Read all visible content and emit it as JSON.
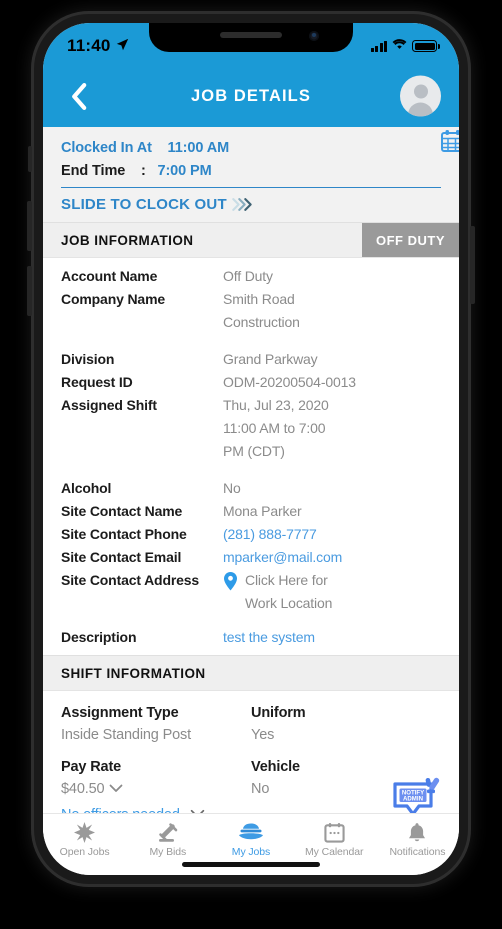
{
  "status_bar": {
    "time": "11:40",
    "location_icon": "location-arrow-icon",
    "signal_icon": "cellular-signal-icon",
    "wifi_icon": "wifi-icon",
    "battery_icon": "battery-icon"
  },
  "nav": {
    "back_icon": "chevron-left-icon",
    "title": "JOB DETAILS",
    "avatar_icon": "user-avatar-icon",
    "bg_color": "#1B9AD6"
  },
  "clock_panel": {
    "clocked_in_label": "Clocked In At",
    "clocked_in_value": "11:00 AM",
    "end_time_label": "End Time",
    "end_time_sep": ":",
    "end_time_value": "7:00 PM",
    "slide_label": "SLIDE TO CLOCK OUT",
    "slide_icon": "triple-chevron-right-icon",
    "accent_color": "#2E86C8"
  },
  "job_information": {
    "section_title": "JOB INFORMATION",
    "status_badge": "OFF DUTY",
    "badge_color": "#9a9a9a",
    "rows": [
      {
        "label": "Account Name",
        "value": "Off Duty",
        "style": "muted"
      },
      {
        "label": "Company Name",
        "value": "Smith Road Construction",
        "style": "muted"
      },
      {
        "label": "Division",
        "value": "Grand Parkway",
        "style": "muted"
      },
      {
        "label": "Request ID",
        "value": "ODM-20200504-0013",
        "style": "muted"
      },
      {
        "label": "Assigned Shift",
        "value": "Thu, Jul 23, 2020 11:00 AM to 7:00 PM (CDT)",
        "style": "muted",
        "icon": "calendar-icon"
      },
      {
        "label": "Alcohol",
        "value": "No",
        "style": "muted"
      },
      {
        "label": "Site Contact Name",
        "value": "Mona Parker",
        "style": "muted"
      },
      {
        "label": "Site Contact Phone",
        "value": "(281) 888-7777",
        "style": "link"
      },
      {
        "label": "Site Contact Email",
        "value": "mparker@mail.com",
        "style": "link"
      },
      {
        "label": "Site Contact Address",
        "value": "Click Here for Work Location",
        "style": "muted",
        "icon": "map-pin-icon"
      },
      {
        "label": "Description",
        "value": "test the system",
        "style": "link"
      }
    ]
  },
  "shift_information": {
    "section_title": "SHIFT INFORMATION",
    "assignment_type_label": "Assignment Type",
    "assignment_type_value": "Inside Standing Post",
    "uniform_label": "Uniform",
    "uniform_value": "Yes",
    "pay_rate_label": "Pay Rate",
    "pay_rate_value": "$40.50",
    "pay_rate_caret": "chevron-down-icon",
    "vehicle_label": "Vehicle",
    "vehicle_value": "No",
    "officers_label": "No officers needed",
    "officers_caret": "chevron-down-icon",
    "notify_admin_icon": "notify-admin-icon",
    "notify_admin_line1": "NOTIFY",
    "notify_admin_line2": "ADMIN"
  },
  "tab_bar": {
    "active_color": "#3E9BE4",
    "inactive_color": "#9a9a9a",
    "tabs": [
      {
        "label": "Open Jobs",
        "icon": "star-burst-icon",
        "active": false
      },
      {
        "label": "My Bids",
        "icon": "gavel-icon",
        "active": false
      },
      {
        "label": "My Jobs",
        "icon": "police-cap-icon",
        "active": true
      },
      {
        "label": "My Calendar",
        "icon": "calendar-icon",
        "active": false
      },
      {
        "label": "Notifications",
        "icon": "bell-icon",
        "active": false
      }
    ]
  }
}
